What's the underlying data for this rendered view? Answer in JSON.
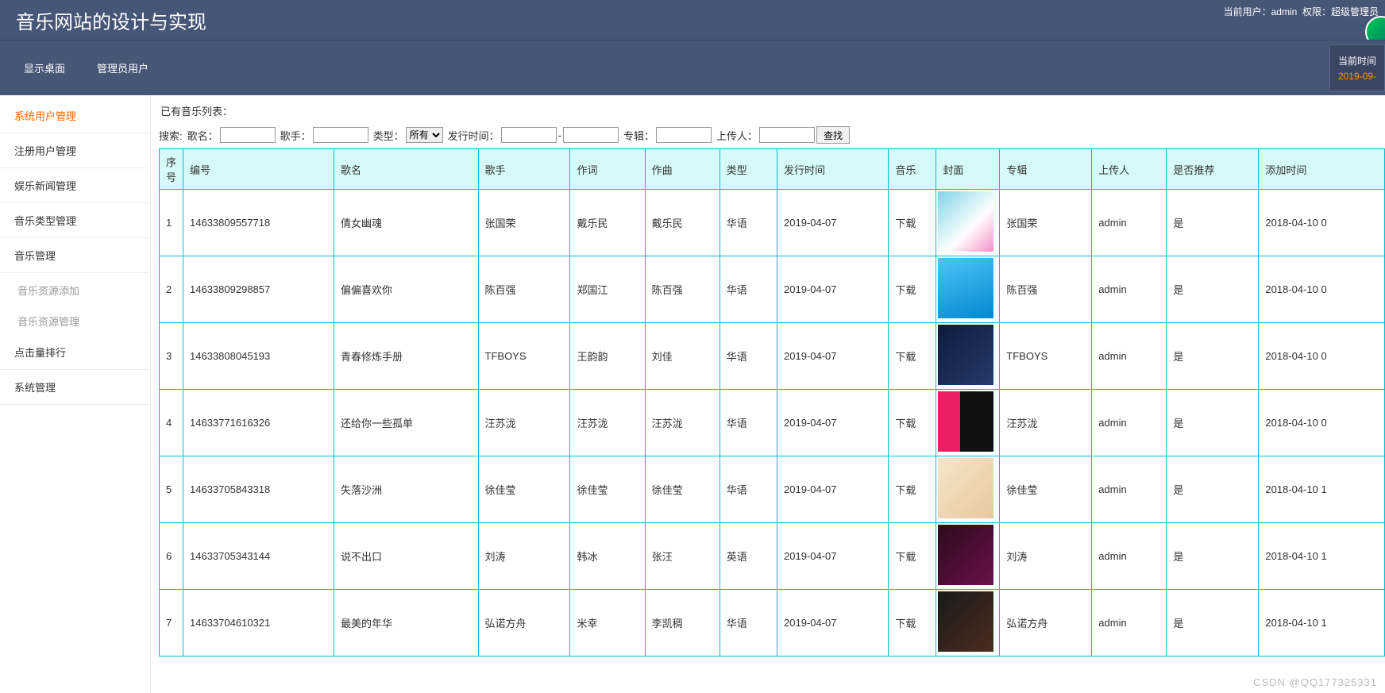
{
  "header": {
    "title": "音乐网站的设计与实现",
    "current_user_label": "当前用户：",
    "user": "admin",
    "role_label": "权限：",
    "role": "超级管理员"
  },
  "topnav": {
    "items": [
      "显示桌面",
      "管理员用户"
    ],
    "time_label": "当前时间",
    "time_value": "2019-09-"
  },
  "sidebar": {
    "items": [
      {
        "label": "系统用户管理",
        "active": true
      },
      {
        "label": "注册用户管理"
      },
      {
        "label": "娱乐新闻管理"
      },
      {
        "label": "音乐类型管理"
      },
      {
        "label": "音乐管理"
      },
      {
        "label": "音乐资源添加",
        "sub": true
      },
      {
        "label": "音乐资源管理",
        "sub": true
      },
      {
        "label": "点击量排行"
      },
      {
        "label": "系统管理"
      }
    ]
  },
  "list_title": "已有音乐列表：",
  "search": {
    "label_search": "搜索:",
    "label_name": "歌名：",
    "label_singer": "歌手：",
    "label_type": "类型：",
    "type_option": "所有",
    "label_pubtime": "发行时间：",
    "dash": "-",
    "label_album": "专辑：",
    "label_uploader": "上传人：",
    "btn_search": "查找"
  },
  "columns": [
    "序号",
    "编号",
    "歌名",
    "歌手",
    "作词",
    "作曲",
    "类型",
    "发行时间",
    "音乐",
    "封面",
    "专辑",
    "上传人",
    "是否推荐",
    "添加时间"
  ],
  "rows": [
    {
      "idx": "1",
      "code": "14633809557718",
      "name": "倩女幽魂",
      "singer": "张国荣",
      "lyric": "戴乐民",
      "composer": "戴乐民",
      "type": "华语",
      "pub": "2019-04-07",
      "music": "下载",
      "thumb": "t1",
      "album": "张国荣",
      "uploader": "admin",
      "rec": "是",
      "added": "2018-04-10 0"
    },
    {
      "idx": "2",
      "code": "14633809298857",
      "name": "偏偏喜欢你",
      "singer": "陈百强",
      "lyric": "郑国江",
      "composer": "陈百强",
      "type": "华语",
      "pub": "2019-04-07",
      "music": "下载",
      "thumb": "t2",
      "album": "陈百强",
      "uploader": "admin",
      "rec": "是",
      "added": "2018-04-10 0"
    },
    {
      "idx": "3",
      "code": "14633808045193",
      "name": "青春修炼手册",
      "singer": "TFBOYS",
      "lyric": "王韵韵",
      "composer": "刘佳",
      "type": "华语",
      "pub": "2019-04-07",
      "music": "下载",
      "thumb": "t3",
      "album": "TFBOYS",
      "uploader": "admin",
      "rec": "是",
      "added": "2018-04-10 0"
    },
    {
      "idx": "4",
      "code": "14633771616326",
      "name": "还给你一些孤单",
      "singer": "汪苏泷",
      "lyric": "汪苏泷",
      "composer": "汪苏泷",
      "type": "华语",
      "pub": "2019-04-07",
      "music": "下载",
      "thumb": "t4",
      "album": "汪苏泷",
      "uploader": "admin",
      "rec": "是",
      "added": "2018-04-10 0"
    },
    {
      "idx": "5",
      "code": "14633705843318",
      "name": "失落沙洲",
      "singer": "徐佳莹",
      "lyric": "徐佳莹",
      "composer": "徐佳莹",
      "type": "华语",
      "pub": "2019-04-07",
      "music": "下载",
      "thumb": "t5",
      "album": "徐佳莹",
      "uploader": "admin",
      "rec": "是",
      "added": "2018-04-10 1"
    },
    {
      "idx": "6",
      "code": "14633705343144",
      "name": "说不出口",
      "singer": "刘涛",
      "lyric": "韩冰",
      "composer": "张汪",
      "type": "英语",
      "pub": "2019-04-07",
      "music": "下载",
      "thumb": "t6",
      "album": "刘涛",
      "uploader": "admin",
      "rec": "是",
      "added": "2018-04-10 1"
    },
    {
      "idx": "7",
      "code": "14633704610321",
      "name": "最美的年华",
      "singer": "弘诺方舟",
      "lyric": "米幸",
      "composer": "李凯稠",
      "type": "华语",
      "pub": "2019-04-07",
      "music": "下载",
      "thumb": "t7",
      "album": "弘诺方舟",
      "uploader": "admin",
      "rec": "是",
      "added": "2018-04-10 1"
    }
  ],
  "watermark": "CSDN @QQ177325331"
}
